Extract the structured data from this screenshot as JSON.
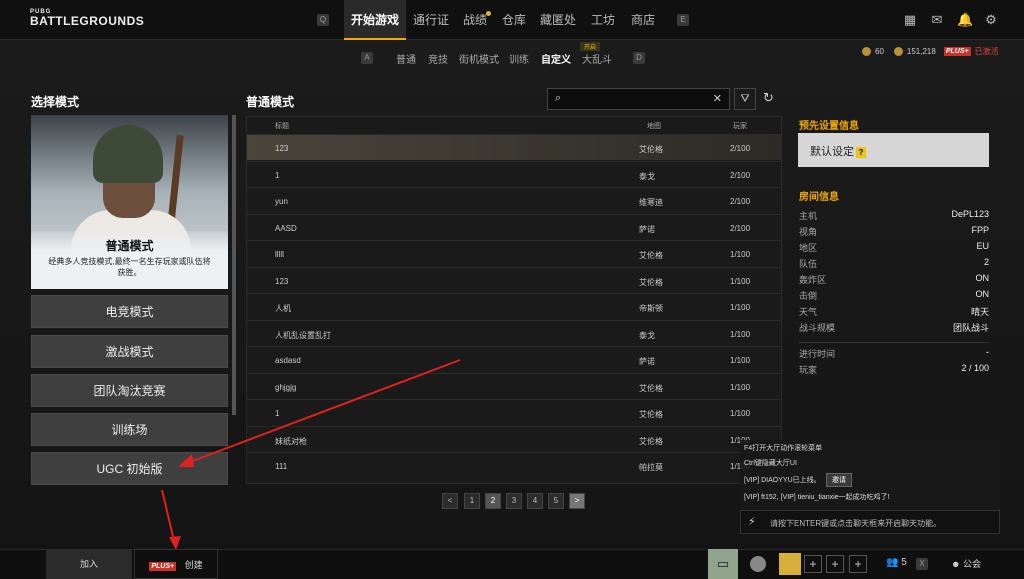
{
  "logo": {
    "small": "PUBG",
    "big": "BATTLEGROUNDS"
  },
  "nav": {
    "key_left": "Q",
    "key_right": "E",
    "items": [
      "开始游戏",
      "通行证",
      "战绩",
      "仓库",
      "藏匿处",
      "工坊",
      "商店"
    ]
  },
  "subnav": {
    "key_left": "A",
    "key_right": "D",
    "items": [
      "普通",
      "竞技",
      "街机模式",
      "训练",
      "自定义",
      "大乱斗"
    ],
    "new_badge": "开启"
  },
  "currency": {
    "coin1": "60",
    "coin2": "151,218",
    "plus_label": "PLUS+",
    "plus_status": "已激活"
  },
  "left": {
    "title": "选择模式",
    "hero_title": "普通模式",
    "hero_desc": "经典多人竞技模式,最终一名生存玩家或队伍将获胜。",
    "modes": [
      "电竞模式",
      "激战模式",
      "团队淘汰竞赛",
      "训练场",
      "UGC 初始版"
    ]
  },
  "list": {
    "title": "普通模式",
    "headers": [
      "标题",
      "地图",
      "玩家"
    ],
    "search_placeholder": "",
    "rows": [
      [
        "123",
        "艾伦格",
        "2/100"
      ],
      [
        "1",
        "泰戈",
        "2/100"
      ],
      [
        "yun",
        "维寒迪",
        "2/100"
      ],
      [
        "AASD",
        "萨诺",
        "2/100"
      ],
      [
        "lllll",
        "艾伦格",
        "1/100"
      ],
      [
        "123",
        "艾伦格",
        "1/100"
      ],
      [
        "人机",
        "帝斯顿",
        "1/100"
      ],
      [
        "人机乱设置乱打",
        "泰戈",
        "1/100"
      ],
      [
        "asdasd",
        "萨诺",
        "1/100"
      ],
      [
        "ghjgjg",
        "艾伦格",
        "1/100"
      ],
      [
        "1",
        "艾伦格",
        "1/100"
      ],
      [
        "妹纸对枪",
        "艾伦格",
        "1/100"
      ],
      [
        "111",
        "帕拉莫",
        "1/100"
      ]
    ]
  },
  "pagination": {
    "pages": [
      "1",
      "2",
      "3",
      "4",
      "5"
    ],
    "current": "2",
    "prev": "<",
    "next": ">"
  },
  "preset": {
    "title": "预先设置信息",
    "value": "默认设定",
    "help": "?"
  },
  "room": {
    "title": "房间信息",
    "items": [
      [
        "主机",
        "DePL123"
      ],
      [
        "视角",
        "FPP"
      ],
      [
        "地区",
        "EU"
      ],
      [
        "队伍",
        "2"
      ],
      [
        "轰炸区",
        "ON"
      ],
      [
        "击倒",
        "ON"
      ],
      [
        "天气",
        "晴天"
      ],
      [
        "战斗规模",
        "团队战斗"
      ]
    ],
    "extra": [
      [
        "进行时间",
        "-"
      ],
      [
        "玩家",
        "2 / 100"
      ]
    ]
  },
  "chat": {
    "lines": [
      "F4打开大厅动作滚轮菜单",
      "Ctrl键隐藏大厅UI",
      "[VIP] DIAOYYU已上线。",
      "[VIP] ft152, [VIP] tieniu_tianxie一起成功吃鸡了!"
    ],
    "invite": "邀请",
    "input_placeholder": "请按下ENTER键或点击聊天框来开启聊天功能。"
  },
  "bottom": {
    "join": "加入",
    "create_badge": "PLUS+",
    "create": "创建",
    "friends": "5",
    "friends_key": "X",
    "guild": "公会"
  }
}
